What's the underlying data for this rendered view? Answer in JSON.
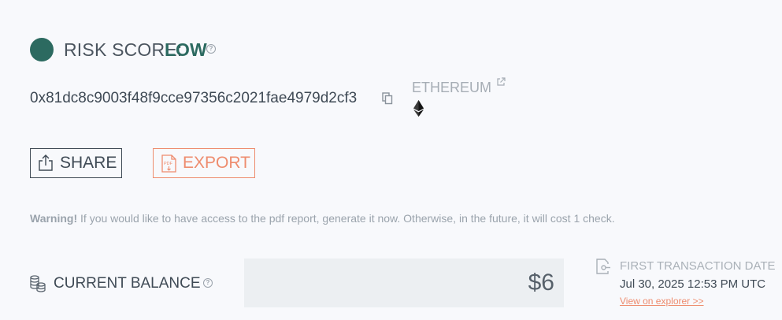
{
  "risk": {
    "label": "RISK SCORE:",
    "level": "LOW",
    "help_icon": "question-icon",
    "color": "#2c6a60"
  },
  "wallet": {
    "address": "0x81dc8c9003f48f9cce97356c2021fae4979d2cf3",
    "copy_icon": "copy-icon",
    "chain": "ETHEREUM",
    "chain_icon": "ethereum-icon",
    "external_link_icon": "external-link-icon"
  },
  "actions": {
    "share_label": "SHARE",
    "share_icon": "share-icon",
    "export_label": "EXPORT",
    "export_icon": "pdf-icon",
    "export_color": "#ee8c6e"
  },
  "warning": {
    "prefix": "Warning!",
    "text": " If you would like to have access to the pdf report, generate it now. Otherwise, in the future, it will cost 1 check."
  },
  "balance": {
    "label": "CURRENT BALANCE",
    "value": "$6",
    "icon": "coins-icon",
    "help_icon": "question-icon"
  },
  "first_transaction": {
    "label": "FIRST TRANSACTION DATE",
    "date": "Jul 30, 2025 12:53 PM UTC",
    "link_text": "View on explorer >>",
    "icon": "transaction-icon"
  }
}
